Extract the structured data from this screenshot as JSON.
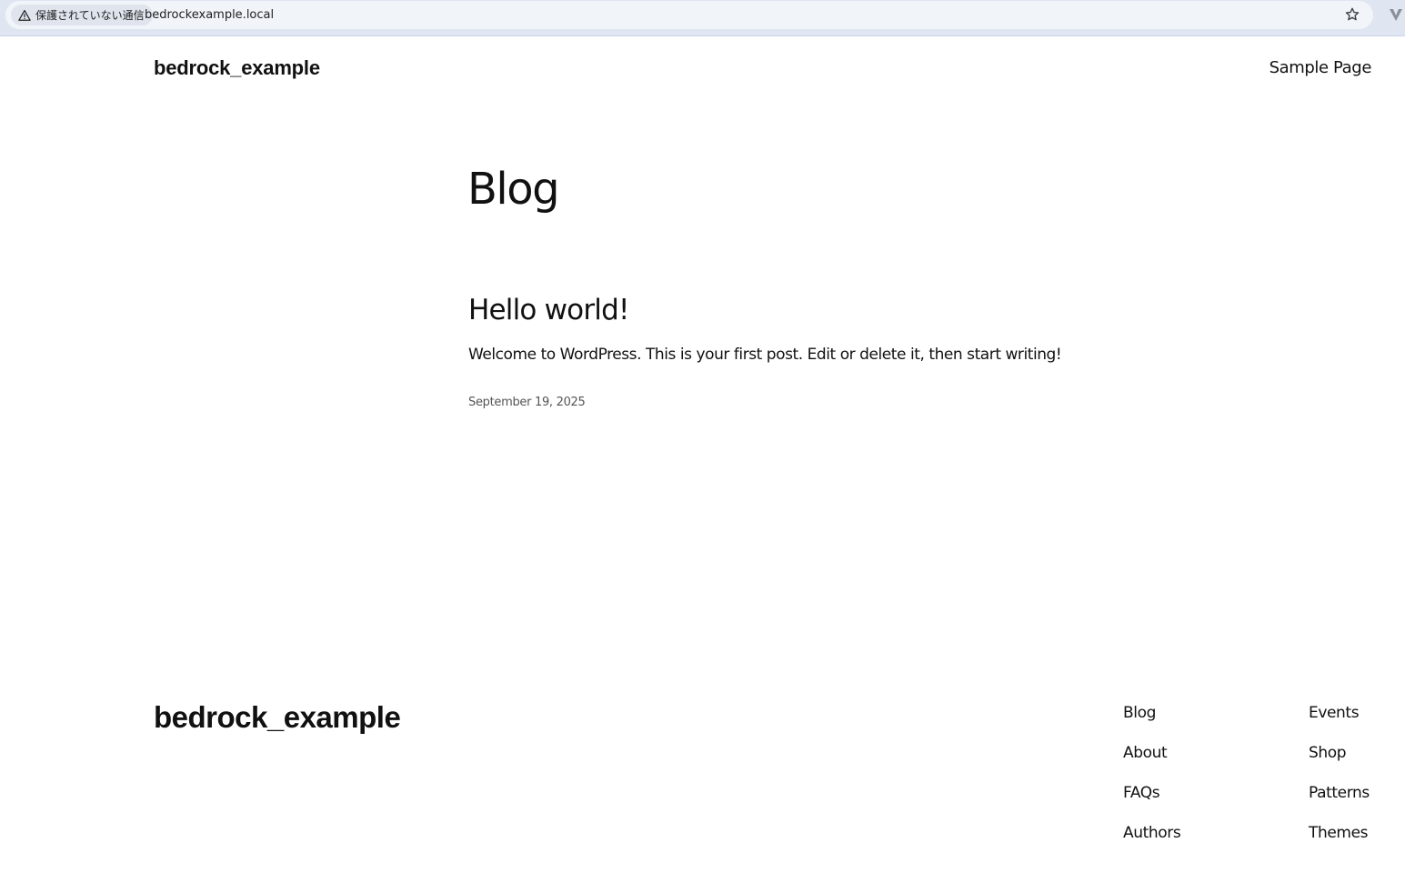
{
  "browser": {
    "security_label": "保護されていない通信",
    "url": "bedrockexample.local",
    "icons": [
      "warning-icon",
      "bookmark-star-icon",
      "extension-icon"
    ]
  },
  "header": {
    "site_title": "bedrock_example",
    "nav": [
      {
        "label": "Sample Page"
      }
    ]
  },
  "main": {
    "page_title": "Blog",
    "posts": [
      {
        "title": "Hello world!",
        "excerpt": "Welcome to WordPress. This is your first post. Edit or delete it, then start writing!",
        "date": "September 19, 2025"
      }
    ]
  },
  "footer": {
    "site_title": "bedrock_example",
    "columns": [
      {
        "links": [
          {
            "label": "Blog"
          },
          {
            "label": "About"
          },
          {
            "label": "FAQs"
          },
          {
            "label": "Authors"
          }
        ]
      },
      {
        "links": [
          {
            "label": "Events"
          },
          {
            "label": "Shop"
          },
          {
            "label": "Patterns"
          },
          {
            "label": "Themes"
          }
        ]
      }
    ]
  },
  "colors": {
    "text": "#111111",
    "muted": "#555555",
    "chrome_bg": "#dfe6f2",
    "omnibox_bg": "#f1f4f9"
  }
}
